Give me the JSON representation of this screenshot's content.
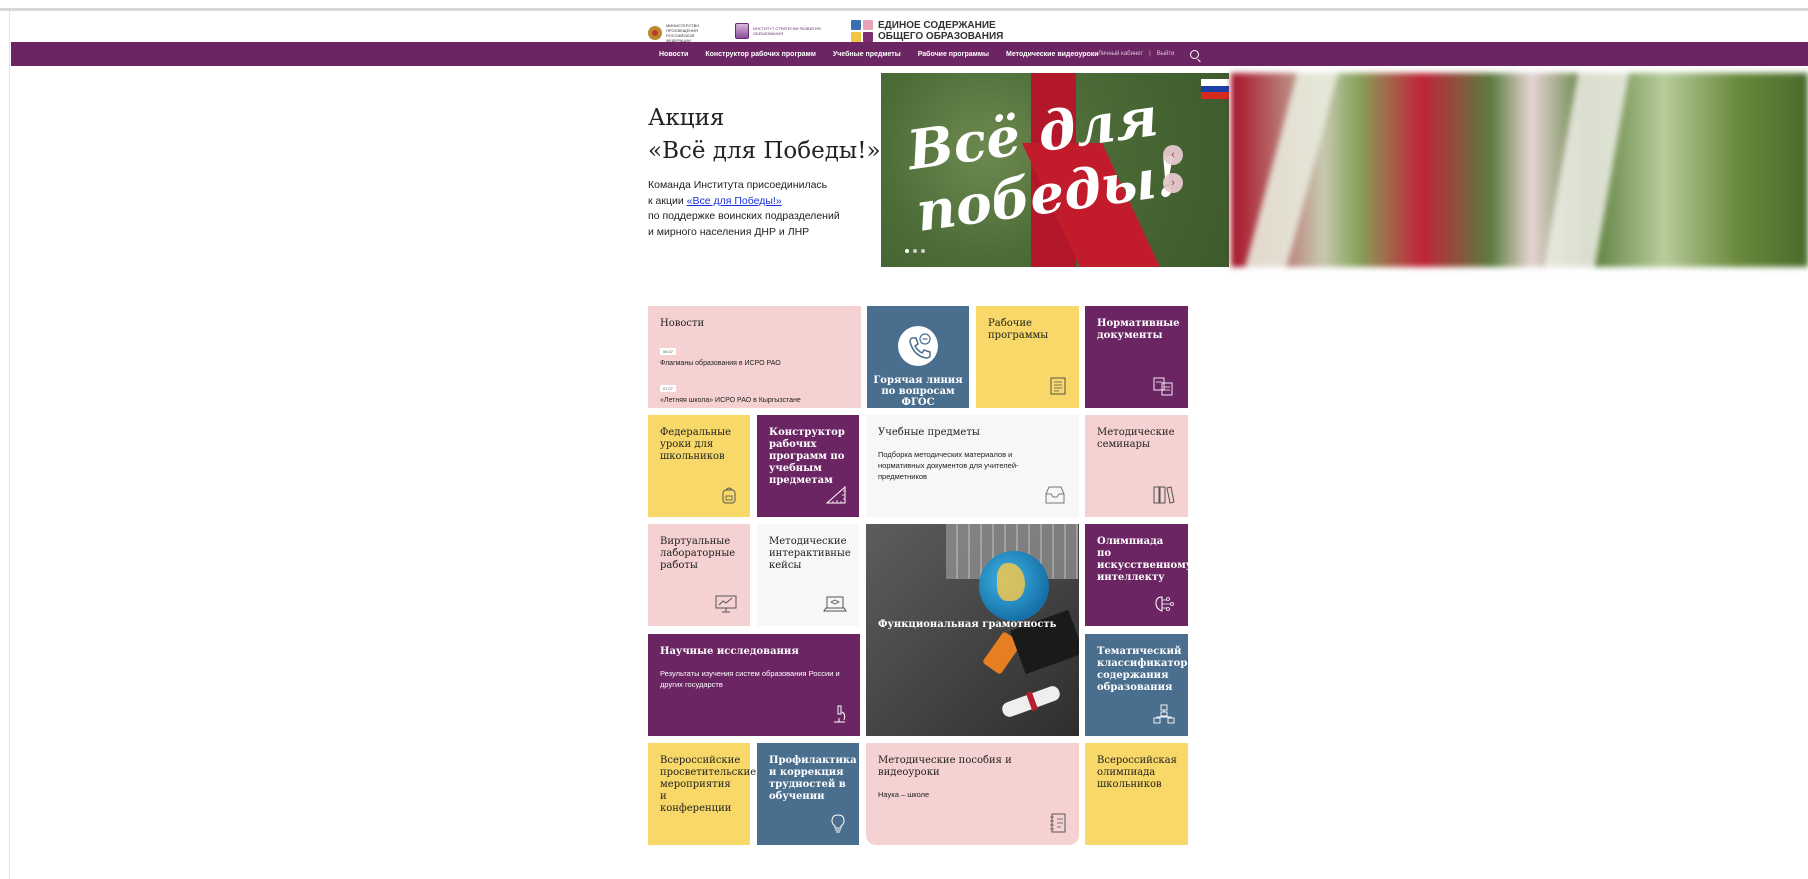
{
  "header": {
    "ministry_text": "Министерство просвещения Российской Федерации",
    "institute_text": "Институт стратегии развития образования",
    "brand_line1": "ЕДИНОЕ СОДЕРЖАНИЕ",
    "brand_line2": "ОБЩЕГО ОБРАЗОВАНИЯ"
  },
  "nav": {
    "items": [
      "Новости",
      "Конструктор рабочих программ",
      "Учебные предметы",
      "Рабочие программы",
      "Методические видеоуроки"
    ],
    "account": "Личный кабинет",
    "separator": "|",
    "logout": "Выйти"
  },
  "hero": {
    "title_line1": "Акция",
    "title_line2": "«Всё для Победы!»",
    "body_line1": "Команда Института присоединилась",
    "body_prefix": "к акции ",
    "body_link": "«Все для Победы!»",
    "body_line3": "по поддержке воинских подразделений",
    "body_line4": "и мирного населения ДНР и ЛНР",
    "slide_text_1": "Всё для",
    "slide_text_2": "победы!",
    "arrow_prev": "‹",
    "arrow_next": "›"
  },
  "tiles": {
    "news": {
      "title": "Новости",
      "items": [
        {
          "date": "06.07",
          "text": "Флагманы образования в ИСРО РАО"
        },
        {
          "date": "07.07",
          "text": "«Летняя школа» ИСРО РАО в Кыргызстане"
        }
      ]
    },
    "hotline": "Горячая линия по вопросам ФГОС",
    "work_programs": "Рабочие программы",
    "normative": "Нормативные документы",
    "federal_lessons": "Федеральные уроки для школьников",
    "constructor": "Конструктор рабочих программ по учебным предметам",
    "subjects": {
      "title": "Учебные предметы",
      "desc": "Подборка методических материалов и нормативных документов для учителей-предметников"
    },
    "seminars": "Методические семинары",
    "virtual_labs": "Виртуальные лабораторные работы",
    "cases": "Методические интерактивные кейсы",
    "functional": "Функциональная грамотность",
    "ai_olympiad": "Олимпиада по искусственному интеллекту",
    "research": {
      "title": "Научные исследования",
      "desc": "Результаты изучения систем образования России и других государств"
    },
    "classifier": "Тематический классификатор содержания образования",
    "events": "Всероссийские просветительские мероприятия и конференции",
    "prevention": "Профилактика и коррекция трудностей в обучении",
    "manuals": {
      "title": "Методические пособия и видеоуроки",
      "desc": "Наука – школе"
    },
    "olympiad": "Всероссийская олимпиада школьников"
  },
  "colors": {
    "purple": "#6b2563",
    "pink": "#f5d2d1",
    "blue": "#4a6e8e",
    "yellow": "#f7d868",
    "link": "#1a32d6"
  }
}
